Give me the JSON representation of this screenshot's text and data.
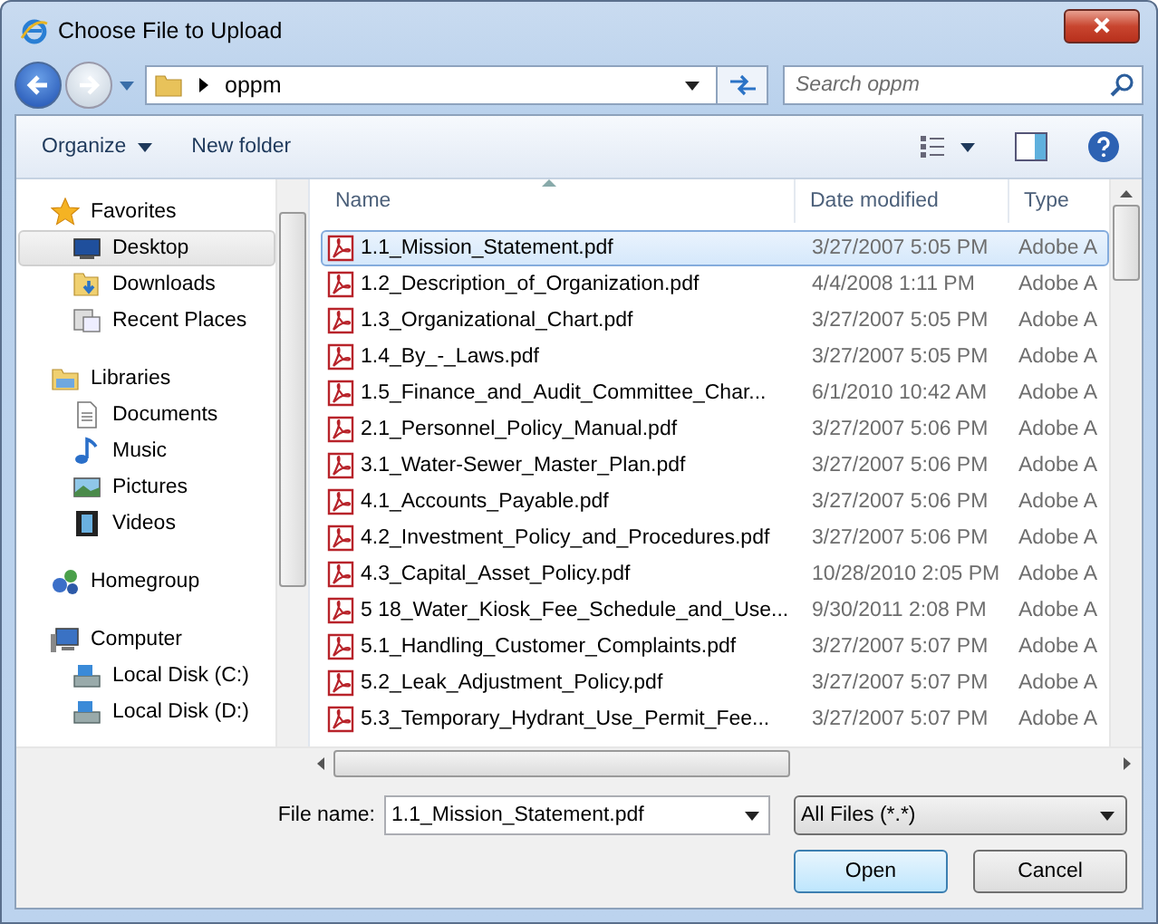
{
  "window": {
    "title": "Choose File to Upload"
  },
  "address": {
    "path": "oppm",
    "search_placeholder": "Search oppm"
  },
  "toolbar": {
    "organize": "Organize",
    "new_folder": "New folder"
  },
  "nav": [
    {
      "label": "Favorites",
      "children": [
        {
          "label": "Desktop",
          "selected": true
        },
        {
          "label": "Downloads",
          "selected": false
        },
        {
          "label": "Recent Places",
          "selected": false
        }
      ]
    },
    {
      "label": "Libraries",
      "children": [
        {
          "label": "Documents",
          "selected": false
        },
        {
          "label": "Music",
          "selected": false
        },
        {
          "label": "Pictures",
          "selected": false
        },
        {
          "label": "Videos",
          "selected": false
        }
      ]
    },
    {
      "label": "Homegroup"
    },
    {
      "label": "Computer",
      "children": [
        {
          "label": "Local Disk (C:)",
          "selected": false
        },
        {
          "label": "Local Disk (D:)",
          "selected": false
        }
      ]
    }
  ],
  "table": {
    "columns": [
      "Name",
      "Date modified",
      "Type"
    ],
    "rows": [
      {
        "name": "1.1_Mission_Statement.pdf",
        "date": "3/27/2007 5:05 PM",
        "type": "Adobe A",
        "selected": true
      },
      {
        "name": "1.2_Description_of_Organization.pdf",
        "date": "4/4/2008 1:11 PM",
        "type": "Adobe A",
        "selected": false
      },
      {
        "name": "1.3_Organizational_Chart.pdf",
        "date": "3/27/2007 5:05 PM",
        "type": "Adobe A",
        "selected": false
      },
      {
        "name": "1.4_By_-_Laws.pdf",
        "date": "3/27/2007 5:05 PM",
        "type": "Adobe A",
        "selected": false
      },
      {
        "name": "1.5_Finance_and_Audit_Committee_Char...",
        "date": "6/1/2010 10:42 AM",
        "type": "Adobe A",
        "selected": false
      },
      {
        "name": "2.1_Personnel_Policy_Manual.pdf",
        "date": "3/27/2007 5:06 PM",
        "type": "Adobe A",
        "selected": false
      },
      {
        "name": "3.1_Water-Sewer_Master_Plan.pdf",
        "date": "3/27/2007 5:06 PM",
        "type": "Adobe A",
        "selected": false
      },
      {
        "name": "4.1_Accounts_Payable.pdf",
        "date": "3/27/2007 5:06 PM",
        "type": "Adobe A",
        "selected": false
      },
      {
        "name": "4.2_Investment_Policy_and_Procedures.pdf",
        "date": "3/27/2007 5:06 PM",
        "type": "Adobe A",
        "selected": false
      },
      {
        "name": "4.3_Capital_Asset_Policy.pdf",
        "date": "10/28/2010 2:05 PM",
        "type": "Adobe A",
        "selected": false
      },
      {
        "name": "5 18_Water_Kiosk_Fee_Schedule_and_Use...",
        "date": "9/30/2011 2:08 PM",
        "type": "Adobe A",
        "selected": false
      },
      {
        "name": "5.1_Handling_Customer_Complaints.pdf",
        "date": "3/27/2007 5:07 PM",
        "type": "Adobe A",
        "selected": false
      },
      {
        "name": "5.2_Leak_Adjustment_Policy.pdf",
        "date": "3/27/2007 5:07 PM",
        "type": "Adobe A",
        "selected": false
      },
      {
        "name": "5.3_Temporary_Hydrant_Use_Permit_Fee...",
        "date": "3/27/2007 5:07 PM",
        "type": "Adobe A",
        "selected": false
      }
    ]
  },
  "filename": {
    "label": "File name:",
    "value": "1.1_Mission_Statement.pdf"
  },
  "filter": {
    "value": "All Files (*.*)"
  },
  "buttons": [
    {
      "label": "Open",
      "kind": "default"
    },
    {
      "label": "Cancel",
      "kind": "normal"
    }
  ]
}
